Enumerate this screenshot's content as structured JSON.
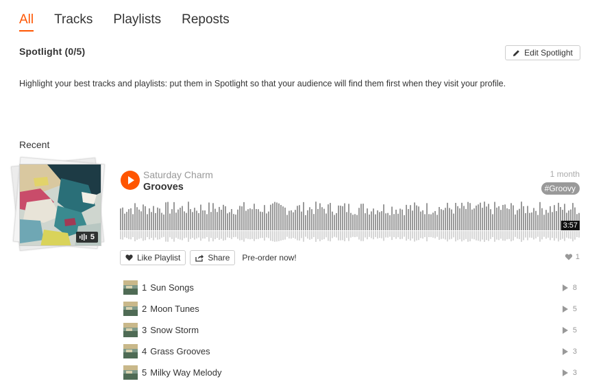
{
  "tabs": [
    {
      "label": "All",
      "active": true
    },
    {
      "label": "Tracks",
      "active": false
    },
    {
      "label": "Playlists",
      "active": false
    },
    {
      "label": "Reposts",
      "active": false
    }
  ],
  "spotlight": {
    "title": "Spotlight (0/5)",
    "edit_label": "Edit Spotlight",
    "description": "Highlight your best tracks and playlists: put them in Spotlight so that your audience will find them first when they visit your profile."
  },
  "recent": {
    "title": "Recent",
    "playlist": {
      "uploader": "Saturday Charm",
      "title": "Grooves",
      "posted": "1 month",
      "tag": "#Groovy",
      "track_count": "5",
      "duration": "3:57",
      "like_label": "Like Playlist",
      "share_label": "Share",
      "preorder_label": "Pre-order now!",
      "like_count": "1",
      "tracks": [
        {
          "num": "1",
          "name": "Sun Songs",
          "plays": "8"
        },
        {
          "num": "2",
          "name": "Moon Tunes",
          "plays": "5"
        },
        {
          "num": "3",
          "name": "Snow Storm",
          "plays": "5"
        },
        {
          "num": "4",
          "name": "Grass Grooves",
          "plays": "3"
        },
        {
          "num": "5",
          "name": "Milky Way Melody",
          "plays": "3"
        }
      ]
    }
  },
  "colors": {
    "accent": "#ff5500",
    "muted": "#999999",
    "text": "#333333"
  },
  "icons": [
    "pencil-icon",
    "play-icon",
    "heart-icon",
    "share-icon",
    "waveform-icon"
  ]
}
